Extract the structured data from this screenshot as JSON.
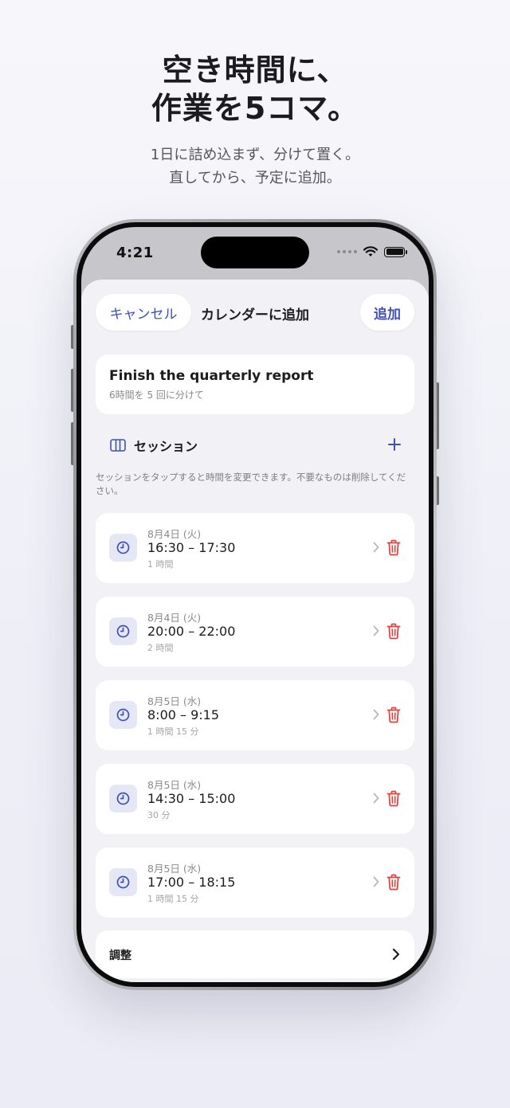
{
  "promo": {
    "headline_line1": "空き時間に、",
    "headline_line2": "作業を5コマ。",
    "sub_line1": "1日に詰め込まず、分けて置く。",
    "sub_line2": "直してから、予定に追加。"
  },
  "status_bar": {
    "time": "4:21"
  },
  "nav": {
    "cancel_label": "キャンセル",
    "title": "カレンダーに追加",
    "add_label": "追加"
  },
  "task": {
    "title": "Finish the quarterly report",
    "subtitle": "6時間を 5 回に分けて"
  },
  "sessions_section": {
    "title": "セッション",
    "add_icon": "plus-icon",
    "hint": "セッションをタップすると時間を変更できます。不要なものは削除してください。"
  },
  "sessions": [
    {
      "date": "8月4日 (火)",
      "time": "16:30 – 17:30",
      "duration": "1 時間"
    },
    {
      "date": "8月4日 (火)",
      "time": "20:00 – 22:00",
      "duration": "2 時間"
    },
    {
      "date": "8月5日 (水)",
      "time": "8:00 – 9:15",
      "duration": "1 時間 15 分"
    },
    {
      "date": "8月5日 (水)",
      "time": "14:30 – 15:00",
      "duration": "30 分"
    },
    {
      "date": "8月5日 (水)",
      "time": "17:00 – 18:15",
      "duration": "1 時間 15 分"
    }
  ],
  "adjust": {
    "label": "調整"
  },
  "colors": {
    "accent": "#3f51b5",
    "delete": "#e0443e",
    "icon_bg": "#e6e7f6",
    "sheet_bg": "#f2f2f6"
  }
}
